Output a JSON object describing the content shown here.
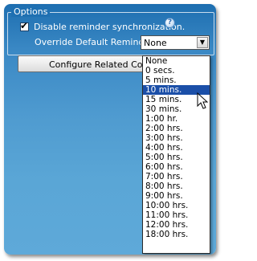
{
  "options_group": {
    "title": "Options",
    "disable_sync": {
      "label": "Disable reminder synchronization.",
      "checked": true,
      "help_icon": "help-icon"
    },
    "override": {
      "label": "Override Default Reminder",
      "selected_value": "None"
    },
    "configure_button": {
      "label": "Configure Related Cont"
    }
  },
  "dropdown": {
    "options": [
      "None",
      "0 secs.",
      "5 mins.",
      "10 mins.",
      "15 mins.",
      "30 mins.",
      "1:00 hr.",
      "2:00 hrs.",
      "3:00 hrs.",
      "4:00 hrs.",
      "5:00 hrs.",
      "6:00 hrs.",
      "7:00 hrs.",
      "8:00 hrs.",
      "9:00 hrs.",
      "10:00 hrs.",
      "11:00 hrs.",
      "12:00 hrs.",
      "18:00 hrs."
    ],
    "highlighted": "10 mins."
  },
  "colors": {
    "panel_top": "#1d6eb0",
    "panel_bottom": "#5ea9d9",
    "highlight": "#1b4fa8"
  }
}
